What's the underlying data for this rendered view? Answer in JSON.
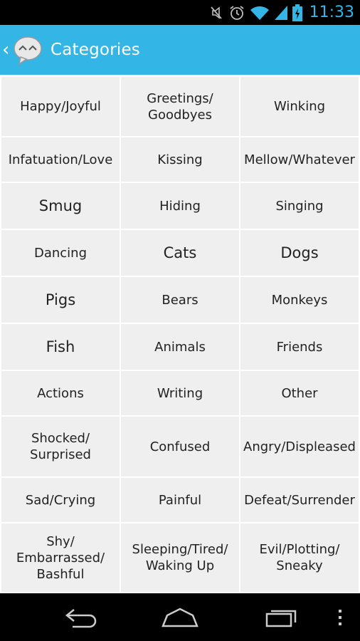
{
  "status_bar": {
    "time": "11:33",
    "icons": [
      "mute-icon",
      "alarm-icon",
      "wifi-icon",
      "signal-icon",
      "battery-charging-icon"
    ]
  },
  "action_bar": {
    "title": "Categories",
    "up_icon": "chevron-left-icon",
    "logo_icon": "emoticon-bubble-icon"
  },
  "categories": [
    "Happy/Joyful",
    "Greetings/\nGoodbyes",
    "Winking",
    "Infatuation/Love",
    "Kissing",
    "Mellow/Whatever",
    "Smug",
    "Hiding",
    "Singing",
    "Dancing",
    "Cats",
    "Dogs",
    "Pigs",
    "Bears",
    "Monkeys",
    "Fish",
    "Animals",
    "Friends",
    "Actions",
    "Writing",
    "Other",
    "Shocked/\nSurprised",
    "Confused",
    "Angry/Displeased",
    "Sad/Crying",
    "Painful",
    "Defeat/Surrender",
    "Shy/\nEmbarrassed/\nBashful",
    "Sleeping/Tired/\nWaking Up",
    "Evil/Plotting/\nSneaky"
  ],
  "nav_bar": {
    "icons": [
      "back-icon",
      "home-icon",
      "recent-apps-icon",
      "menu-icon"
    ]
  },
  "colors": {
    "accent": "#33b5e5",
    "cell_bg": "#efefef",
    "text": "#222222"
  }
}
